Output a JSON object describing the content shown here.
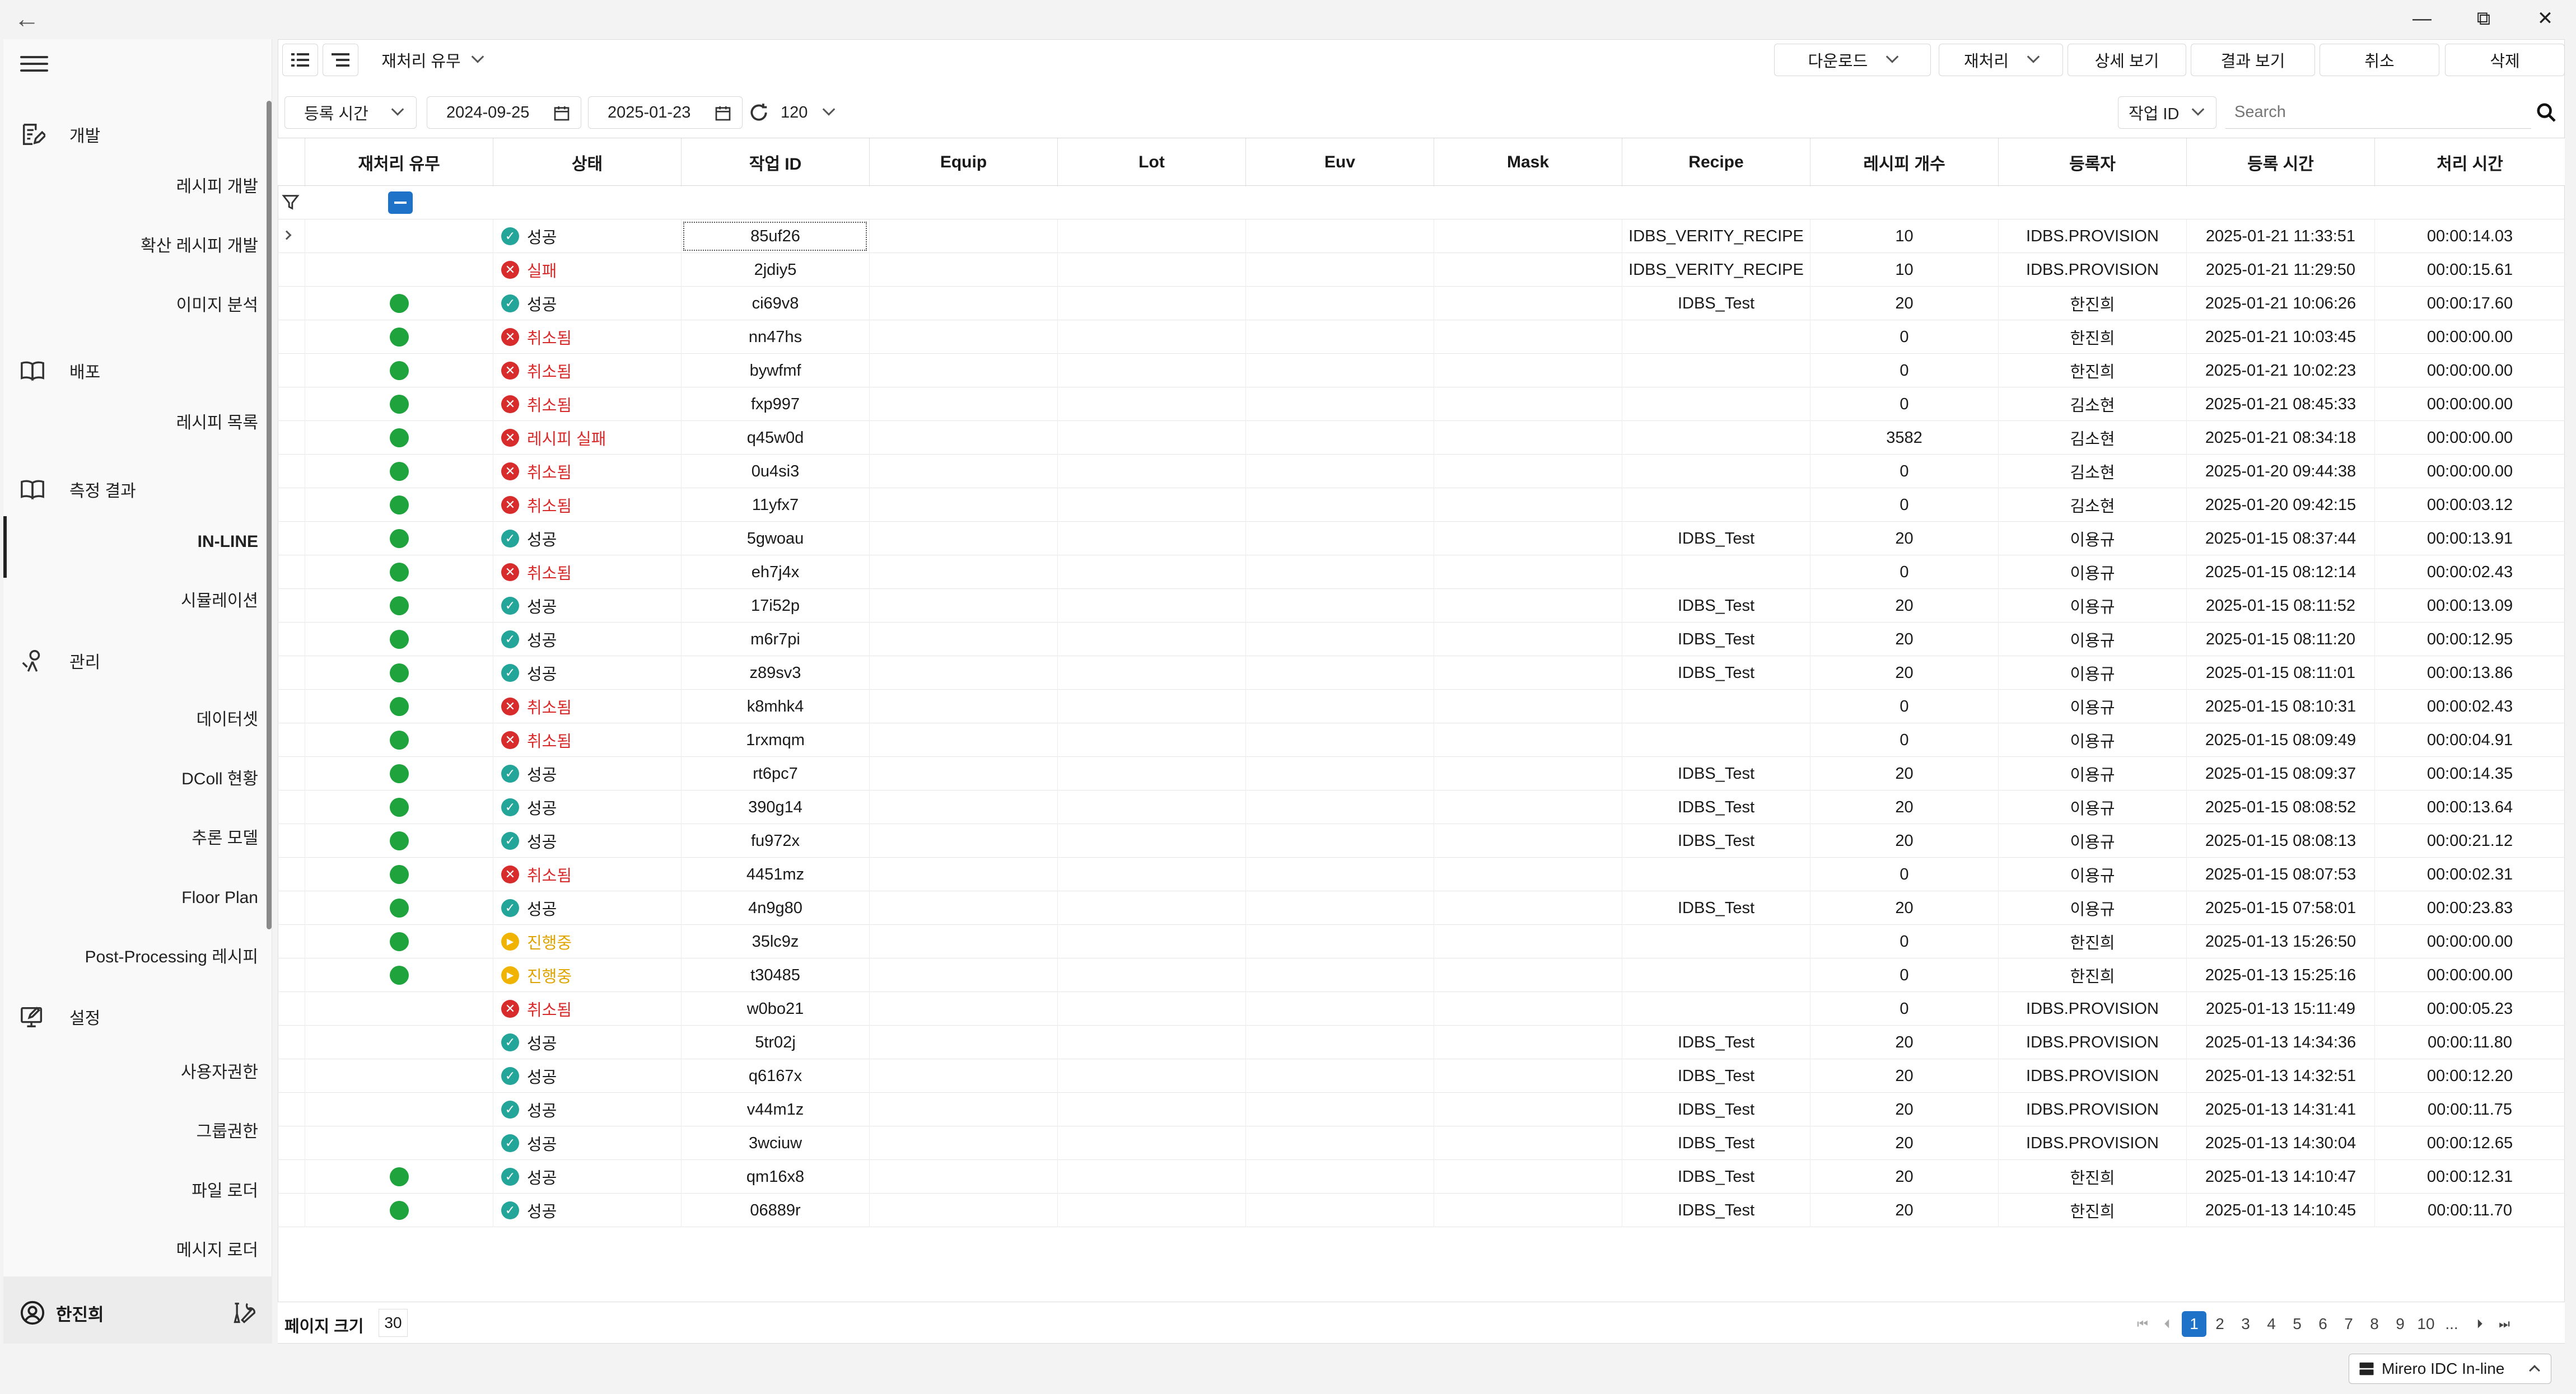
{
  "sidebar": {
    "groups": [
      {
        "label": "개발",
        "icon": "edit-document-icon",
        "top": 0
      },
      {
        "label": "배포",
        "icon": "book-icon"
      },
      {
        "label": "측정 결과",
        "icon": "book-icon"
      },
      {
        "label": "관리",
        "icon": "wrench-user-icon"
      },
      {
        "label": "설정",
        "icon": "monitor-edit-icon"
      }
    ],
    "items": [
      "레시피 개발",
      "확산 레시피 개발",
      "이미지 분석",
      "레시피 목록",
      "IN-LINE",
      "시뮬레이션",
      "데이터셋",
      "DColl 현황",
      "추론 모델",
      "Floor Plan",
      "Post-Processing 레시피",
      "사용자권한",
      "그룹권한",
      "파일 로더",
      "메시지 로더"
    ],
    "user": "한진희"
  },
  "toolbar": {
    "reprocess_filter": "재처리 유무",
    "download": "다운로드",
    "reprocess": "재처리",
    "detail": "상세 보기",
    "result": "결과 보기",
    "cancel": "취소",
    "delete": "삭제"
  },
  "filters": {
    "time_type": "등록 시간",
    "date_from": "2024-09-25",
    "date_to": "2025-01-23",
    "refresh_count": "120",
    "search_field": "작업 ID",
    "search_placeholder": "Search"
  },
  "columns": [
    "재처리 유무",
    "상태",
    "작업 ID",
    "Equip",
    "Lot",
    "Euv",
    "Mask",
    "Recipe",
    "레시피 개수",
    "등록자",
    "등록 시간",
    "처리 시간"
  ],
  "rows": [
    {
      "re": false,
      "st": "ok",
      "status": "성공",
      "id": "85uf26",
      "recipe": "IDBS_VERITY_RECIPE",
      "count": "10",
      "user": "IDBS.PROVISION",
      "time": "2025-01-21 11:33:51",
      "dur": "00:00:14.03"
    },
    {
      "re": false,
      "st": "fail",
      "status": "실패",
      "id": "2jdiy5",
      "recipe": "IDBS_VERITY_RECIPE",
      "count": "10",
      "user": "IDBS.PROVISION",
      "time": "2025-01-21 11:29:50",
      "dur": "00:00:15.61"
    },
    {
      "re": true,
      "st": "ok",
      "status": "성공",
      "id": "ci69v8",
      "recipe": "IDBS_Test",
      "count": "20",
      "user": "한진희",
      "time": "2025-01-21 10:06:26",
      "dur": "00:00:17.60"
    },
    {
      "re": true,
      "st": "fail",
      "status": "취소됨",
      "id": "nn47hs",
      "recipe": "",
      "count": "0",
      "user": "한진희",
      "time": "2025-01-21 10:03:45",
      "dur": "00:00:00.00"
    },
    {
      "re": true,
      "st": "fail",
      "status": "취소됨",
      "id": "bywfmf",
      "recipe": "",
      "count": "0",
      "user": "한진희",
      "time": "2025-01-21 10:02:23",
      "dur": "00:00:00.00"
    },
    {
      "re": true,
      "st": "fail",
      "status": "취소됨",
      "id": "fxp997",
      "recipe": "",
      "count": "0",
      "user": "김소현",
      "time": "2025-01-21 08:45:33",
      "dur": "00:00:00.00"
    },
    {
      "re": true,
      "st": "fail",
      "status": "레시피 실패",
      "id": "q45w0d",
      "recipe": "",
      "count": "3582",
      "user": "김소현",
      "time": "2025-01-21 08:34:18",
      "dur": "00:00:00.00"
    },
    {
      "re": true,
      "st": "fail",
      "status": "취소됨",
      "id": "0u4si3",
      "recipe": "",
      "count": "0",
      "user": "김소현",
      "time": "2025-01-20 09:44:38",
      "dur": "00:00:00.00"
    },
    {
      "re": true,
      "st": "fail",
      "status": "취소됨",
      "id": "11yfx7",
      "recipe": "",
      "count": "0",
      "user": "김소현",
      "time": "2025-01-20 09:42:15",
      "dur": "00:00:03.12"
    },
    {
      "re": true,
      "st": "ok",
      "status": "성공",
      "id": "5gwoau",
      "recipe": "IDBS_Test",
      "count": "20",
      "user": "이용규",
      "time": "2025-01-15 08:37:44",
      "dur": "00:00:13.91"
    },
    {
      "re": true,
      "st": "fail",
      "status": "취소됨",
      "id": "eh7j4x",
      "recipe": "",
      "count": "0",
      "user": "이용규",
      "time": "2025-01-15 08:12:14",
      "dur": "00:00:02.43"
    },
    {
      "re": true,
      "st": "ok",
      "status": "성공",
      "id": "17i52p",
      "recipe": "IDBS_Test",
      "count": "20",
      "user": "이용규",
      "time": "2025-01-15 08:11:52",
      "dur": "00:00:13.09"
    },
    {
      "re": true,
      "st": "ok",
      "status": "성공",
      "id": "m6r7pi",
      "recipe": "IDBS_Test",
      "count": "20",
      "user": "이용규",
      "time": "2025-01-15 08:11:20",
      "dur": "00:00:12.95"
    },
    {
      "re": true,
      "st": "ok",
      "status": "성공",
      "id": "z89sv3",
      "recipe": "IDBS_Test",
      "count": "20",
      "user": "이용규",
      "time": "2025-01-15 08:11:01",
      "dur": "00:00:13.86"
    },
    {
      "re": true,
      "st": "fail",
      "status": "취소됨",
      "id": "k8mhk4",
      "recipe": "",
      "count": "0",
      "user": "이용규",
      "time": "2025-01-15 08:10:31",
      "dur": "00:00:02.43"
    },
    {
      "re": true,
      "st": "fail",
      "status": "취소됨",
      "id": "1rxmqm",
      "recipe": "",
      "count": "0",
      "user": "이용규",
      "time": "2025-01-15 08:09:49",
      "dur": "00:00:04.91"
    },
    {
      "re": true,
      "st": "ok",
      "status": "성공",
      "id": "rt6pc7",
      "recipe": "IDBS_Test",
      "count": "20",
      "user": "이용규",
      "time": "2025-01-15 08:09:37",
      "dur": "00:00:14.35"
    },
    {
      "re": true,
      "st": "ok",
      "status": "성공",
      "id": "390g14",
      "recipe": "IDBS_Test",
      "count": "20",
      "user": "이용규",
      "time": "2025-01-15 08:08:52",
      "dur": "00:00:13.64"
    },
    {
      "re": true,
      "st": "ok",
      "status": "성공",
      "id": "fu972x",
      "recipe": "IDBS_Test",
      "count": "20",
      "user": "이용규",
      "time": "2025-01-15 08:08:13",
      "dur": "00:00:21.12"
    },
    {
      "re": true,
      "st": "fail",
      "status": "취소됨",
      "id": "4451mz",
      "recipe": "",
      "count": "0",
      "user": "이용규",
      "time": "2025-01-15 08:07:53",
      "dur": "00:00:02.31"
    },
    {
      "re": true,
      "st": "ok",
      "status": "성공",
      "id": "4n9g80",
      "recipe": "IDBS_Test",
      "count": "20",
      "user": "이용규",
      "time": "2025-01-15 07:58:01",
      "dur": "00:00:23.83"
    },
    {
      "re": true,
      "st": "run",
      "status": "진행중",
      "id": "35lc9z",
      "recipe": "",
      "count": "0",
      "user": "한진희",
      "time": "2025-01-13 15:26:50",
      "dur": "00:00:00.00"
    },
    {
      "re": true,
      "st": "run",
      "status": "진행중",
      "id": "t30485",
      "recipe": "",
      "count": "0",
      "user": "한진희",
      "time": "2025-01-13 15:25:16",
      "dur": "00:00:00.00"
    },
    {
      "re": false,
      "st": "fail",
      "status": "취소됨",
      "id": "w0bo21",
      "recipe": "",
      "count": "0",
      "user": "IDBS.PROVISION",
      "time": "2025-01-13 15:11:49",
      "dur": "00:00:05.23"
    },
    {
      "re": false,
      "st": "ok",
      "status": "성공",
      "id": "5tr02j",
      "recipe": "IDBS_Test",
      "count": "20",
      "user": "IDBS.PROVISION",
      "time": "2025-01-13 14:34:36",
      "dur": "00:00:11.80"
    },
    {
      "re": false,
      "st": "ok",
      "status": "성공",
      "id": "q6167x",
      "recipe": "IDBS_Test",
      "count": "20",
      "user": "IDBS.PROVISION",
      "time": "2025-01-13 14:32:51",
      "dur": "00:00:12.20"
    },
    {
      "re": false,
      "st": "ok",
      "status": "성공",
      "id": "v44m1z",
      "recipe": "IDBS_Test",
      "count": "20",
      "user": "IDBS.PROVISION",
      "time": "2025-01-13 14:31:41",
      "dur": "00:00:11.75"
    },
    {
      "re": false,
      "st": "ok",
      "status": "성공",
      "id": "3wciuw",
      "recipe": "IDBS_Test",
      "count": "20",
      "user": "IDBS.PROVISION",
      "time": "2025-01-13 14:30:04",
      "dur": "00:00:12.65"
    },
    {
      "re": true,
      "st": "ok",
      "status": "성공",
      "id": "qm16x8",
      "recipe": "IDBS_Test",
      "count": "20",
      "user": "한진희",
      "time": "2025-01-13 14:10:47",
      "dur": "00:00:12.31"
    },
    {
      "re": true,
      "st": "ok",
      "status": "성공",
      "id": "06889r",
      "recipe": "IDBS_Test",
      "count": "20",
      "user": "한진희",
      "time": "2025-01-13 14:10:45",
      "dur": "00:00:11.70"
    }
  ],
  "footer": {
    "page_size_label": "페이지 크기",
    "page_size": "30",
    "pages": [
      "1",
      "2",
      "3",
      "4",
      "5",
      "6",
      "7",
      "8",
      "9",
      "10",
      "..."
    ],
    "current_page": "1",
    "status": "Mirero IDC In-line"
  },
  "colors": {
    "accent": "#1e73c8",
    "success": "#23a59a",
    "fail": "#d82b2b",
    "running": "#f0b400",
    "reprocess_dot": "#1fa33c"
  }
}
